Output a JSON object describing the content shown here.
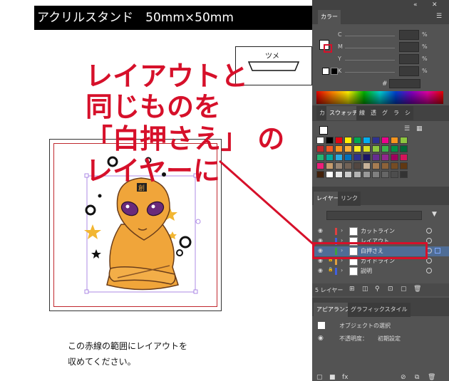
{
  "artboard": {
    "title": "アクリルスタンド　50mm×50mm",
    "tsume_label": "ツメ",
    "annotation_lines": [
      "レイアウトと",
      "同じものを",
      "「白押さえ」 の",
      "レイヤーに"
    ],
    "caption_lines": [
      "この赤線の範囲にレイアウトを",
      "収めてください。"
    ],
    "colors": {
      "annotation": "#d6102a",
      "cutline": "#c0282e"
    }
  },
  "color_panel": {
    "tab": "カラー",
    "channels": [
      {
        "label": "C",
        "unit": "%"
      },
      {
        "label": "M",
        "unit": "%"
      },
      {
        "label": "Y",
        "unit": "%"
      },
      {
        "label": "K",
        "unit": "%"
      }
    ],
    "hex_label": "#"
  },
  "swatch_panel": {
    "tabs": [
      "カ",
      "スウォッチ",
      "線",
      "透",
      "グ",
      "ラ",
      "シ"
    ],
    "colors": [
      "#ffffff",
      "#000000",
      "#e30613",
      "#ffed00",
      "#00a651",
      "#00aeef",
      "#2e3192",
      "#ec008c",
      "#f7941d",
      "#8dc63f",
      "#c1272d",
      "#f15a24",
      "#f7931e",
      "#fbb03b",
      "#fcee21",
      "#d9e021",
      "#8cc63f",
      "#39b54a",
      "#009245",
      "#006837",
      "#22b573",
      "#00a99d",
      "#29abe2",
      "#0071bc",
      "#2e3192",
      "#1b1464",
      "#662d91",
      "#93278f",
      "#9e005d",
      "#d4145a",
      "#ed1e79",
      "#c69c6d",
      "#998675",
      "#736357",
      "#534741",
      "#c7b299",
      "#a67c52",
      "#8c6239",
      "#754c24",
      "#603813",
      "#42210b",
      "#ffffff",
      "#e6e6e6",
      "#cccccc",
      "#b3b3b3",
      "#999999",
      "#808080",
      "#666666",
      "#4d4d4d",
      "#333333"
    ]
  },
  "layers_panel": {
    "tabs": [
      "レイヤー",
      "リンク"
    ],
    "layers": [
      {
        "name": "カットライン",
        "color": "#e04040",
        "selected": false
      },
      {
        "name": "レイアウト",
        "color": "#4060e0",
        "selected": false
      },
      {
        "name": "白押さえ",
        "color": "#40a040",
        "selected": true
      },
      {
        "name": "ガイドライン",
        "color": "#e0a040",
        "selected": false
      },
      {
        "name": "説明",
        "color": "#4060e0",
        "selected": false
      }
    ],
    "count_label": "5 レイヤー"
  },
  "appearance_panel": {
    "tabs": [
      "アピアランス",
      "グラフィックスタイル"
    ],
    "object_label": "オブジェクトの選択",
    "opacity_label": "不透明度：",
    "opacity_value": "初期設定"
  }
}
